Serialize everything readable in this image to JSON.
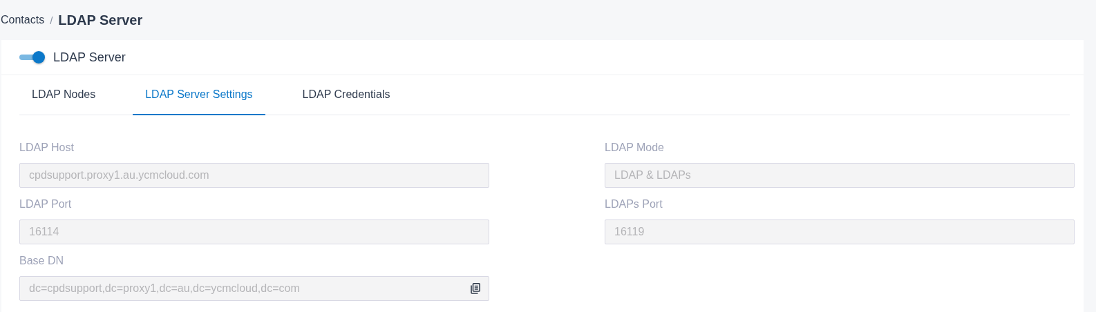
{
  "breadcrumb": {
    "parent": "Contacts",
    "separator": "/",
    "current": "LDAP Server"
  },
  "server_toggle": {
    "label": "LDAP Server",
    "on": true
  },
  "tabs": [
    {
      "label": "LDAP Nodes",
      "selected": false
    },
    {
      "label": "LDAP Server Settings",
      "selected": true
    },
    {
      "label": "LDAP Credentials",
      "selected": false
    }
  ],
  "fields": [
    {
      "label": "LDAP Host",
      "value": "cpdsupport.proxy1.au.ycmcloud.com",
      "disabled": true,
      "copyable": false
    },
    {
      "label": "LDAP Mode",
      "value": "LDAP & LDAPs",
      "disabled": true,
      "copyable": false
    },
    {
      "label": "LDAP Port",
      "value": "16114",
      "disabled": true,
      "copyable": false
    },
    {
      "label": "LDAPs Port",
      "value": "16119",
      "disabled": true,
      "copyable": false
    },
    {
      "label": "Base DN",
      "value": "dc=cpdsupport,dc=proxy1,dc=au,dc=ycmcloud,dc=com",
      "disabled": true,
      "copyable": true
    }
  ]
}
